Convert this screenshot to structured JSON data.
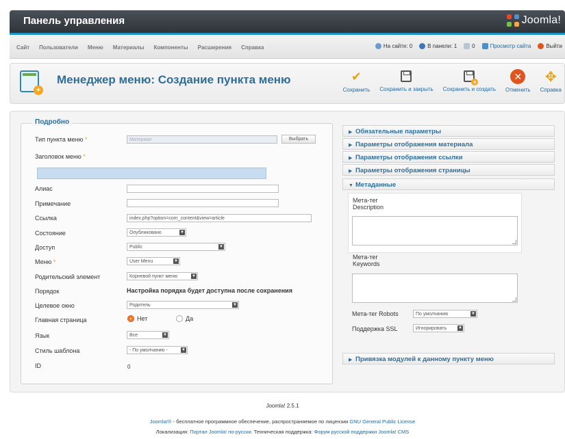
{
  "header": {
    "title": "Панель управления",
    "logo_text": "Joomla!"
  },
  "nav": {
    "items": [
      "Сайт",
      "Пользователи",
      "Меню",
      "Материалы",
      "Компоненты",
      "Расширения",
      "Справка"
    ]
  },
  "status": {
    "on_site": "На сайте: 0",
    "in_admin": "В панели: 1",
    "messages": "0",
    "view_site": "Просмотр сайта",
    "logout": "Выйти"
  },
  "toolbar": {
    "title": "Менеджер меню: Создание пункта меню",
    "save": "Сохранить",
    "save_close": "Сохранить и закрыть",
    "save_new": "Сохранить и создать",
    "cancel": "Отменить",
    "help": "Справка"
  },
  "form": {
    "legend": "Подробно",
    "menu_type_label": "Тип пункта меню",
    "menu_type_value": "Материал",
    "choose_button": "Выбрать",
    "title_label": "Заголовок меню",
    "alias_label": "Алиас",
    "note_label": "Примечание",
    "link_label": "Ссылка",
    "link_value": "index.php?option=com_content&view=article",
    "state_label": "Состояние",
    "state_value": "Опубликовано",
    "access_label": "Доступ",
    "access_value": "Public",
    "menu_label": "Меню",
    "menu_value": "User Menu",
    "parent_label": "Родительский элемент",
    "parent_value": "Корневой пункт меню",
    "order_label": "Порядок",
    "order_text": "Настройка порядка будет доступна после сохранения",
    "target_label": "Целевое окно",
    "target_value": "Родитель",
    "home_label": "Главная страница",
    "home_no": "Нет",
    "home_yes": "Да",
    "language_label": "Язык",
    "language_value": "Все",
    "template_label": "Стиль шаблона",
    "template_value": "- По умолчанию -",
    "id_label": "ID",
    "id_value": "0"
  },
  "accordion": {
    "required": "Обязательные параметры",
    "article_display": "Параметры отображения материала",
    "link_display": "Параметры отображения ссылки",
    "page_display": "Параметры отображения страницы",
    "metadata": "Метаданные",
    "module_binding": "Привязка модулей к данному пункту меню"
  },
  "metadata": {
    "desc_label_1": "Мета-тег",
    "desc_label_2": "Description",
    "keywords_label_1": "Мета-тег",
    "keywords_label_2": "Keywords",
    "robots_label": "Мета-тег Robots",
    "robots_value": "По умолчанию",
    "ssl_label": "Поддержка SSL",
    "ssl_value": "Игнорировать"
  },
  "footer": {
    "version": "Joomla! 2.5.1",
    "line1_link": "Joomla!®",
    "line1_text": " - бесплатное программное обеспечение, распространяемое по лицензии ",
    "line1_license": "GNU General Public License",
    "line2_text1": "Локализация: ",
    "line2_link1": "Портал Joomla! по-русски",
    "line2_text2": ". Техническая поддержка: ",
    "line2_link2": "Форум русской поддержки Joomla! CMS"
  }
}
